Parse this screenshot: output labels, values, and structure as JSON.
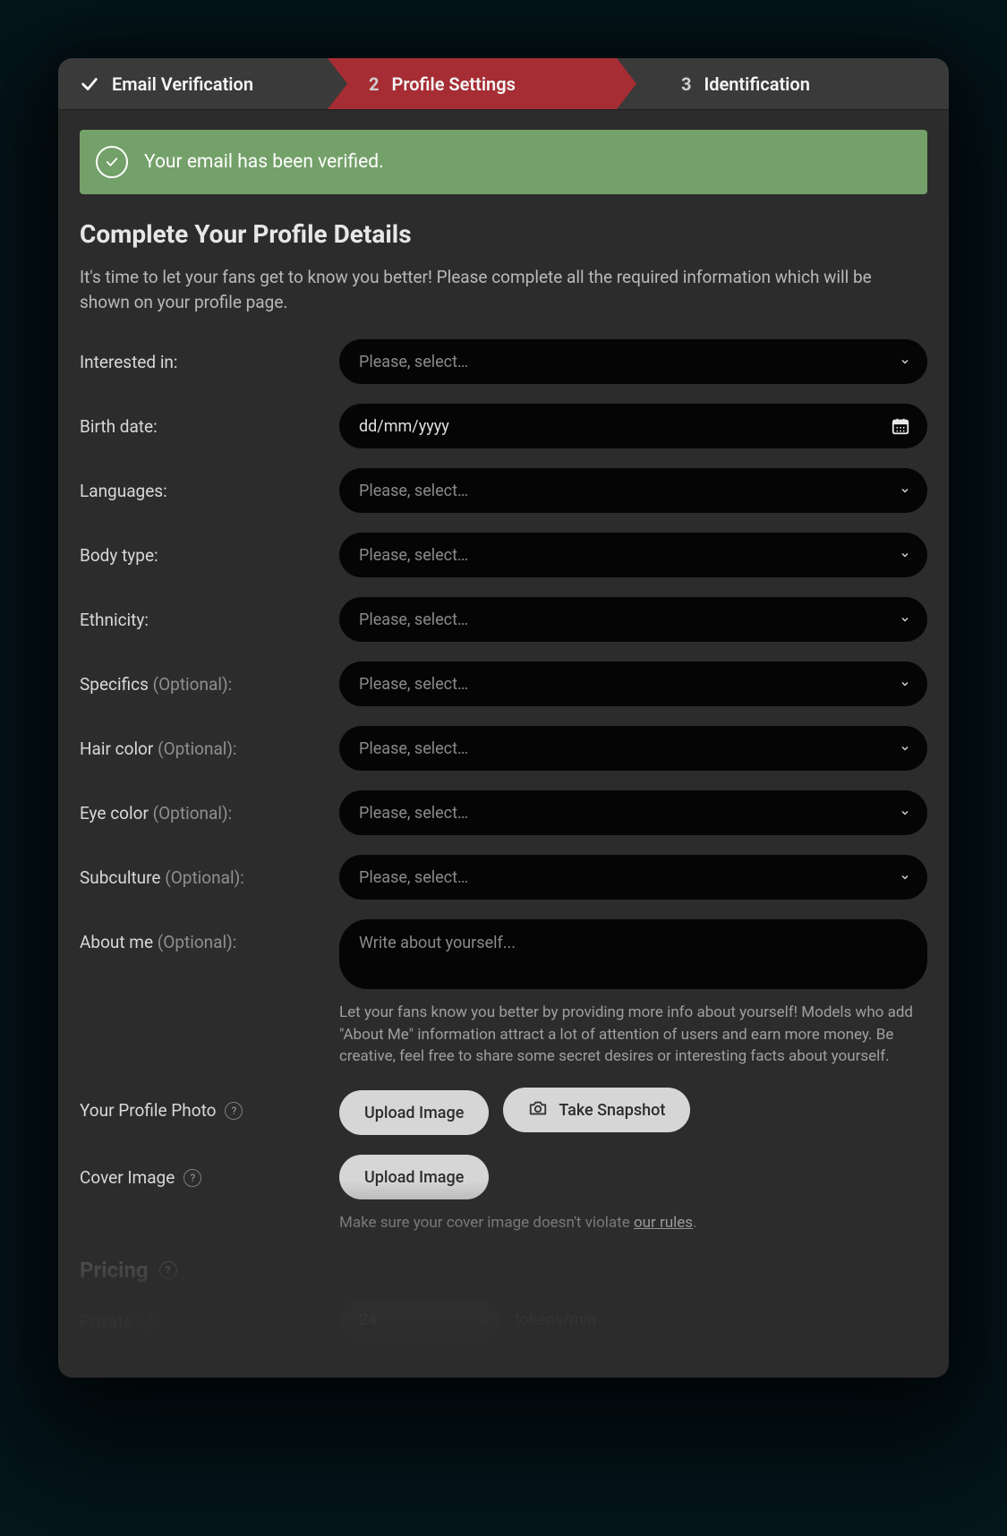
{
  "steps": {
    "one_label": "Email Verification",
    "two_num": "2",
    "two_label": "Profile Settings",
    "three_num": "3",
    "three_label": "Identification"
  },
  "banner": {
    "message": "Your email has been verified."
  },
  "heading": "Complete Your Profile Details",
  "intro": "It's time to let your fans get to know you better! Please complete all the required information which will be shown on your profile page.",
  "labels": {
    "interested": "Interested in:",
    "birth": "Birth date:",
    "languages": "Languages:",
    "body": "Body type:",
    "ethnicity": "Ethnicity:",
    "specifics": "Specifics ",
    "hair": "Hair color ",
    "eye": "Eye color ",
    "subculture": "Subculture ",
    "about": "About me ",
    "optional": "(Optional):",
    "profile_photo": "Your Profile Photo",
    "cover_image": "Cover Image",
    "private": "Private"
  },
  "placeholders": {
    "select": "Please, select…",
    "date": "dd/mm/yyyy",
    "about": "Write about yourself..."
  },
  "about_helper": "Let your fans know you better by providing more info about yourself! Models who add \"About Me\" information attract a lot of attention of users and earn more money. Be creative, feel free to share some secret desires or interesting facts about yourself.",
  "buttons": {
    "upload_image": "Upload Image",
    "take_snapshot": "Take Snapshot"
  },
  "cover_helper_prefix": "Make sure your cover image doesn't violate ",
  "cover_helper_link": "our rules",
  "cover_helper_suffix": ".",
  "pricing": {
    "title": "Pricing",
    "private_value": "24",
    "unit": "tokens/min"
  },
  "help_q": "?"
}
